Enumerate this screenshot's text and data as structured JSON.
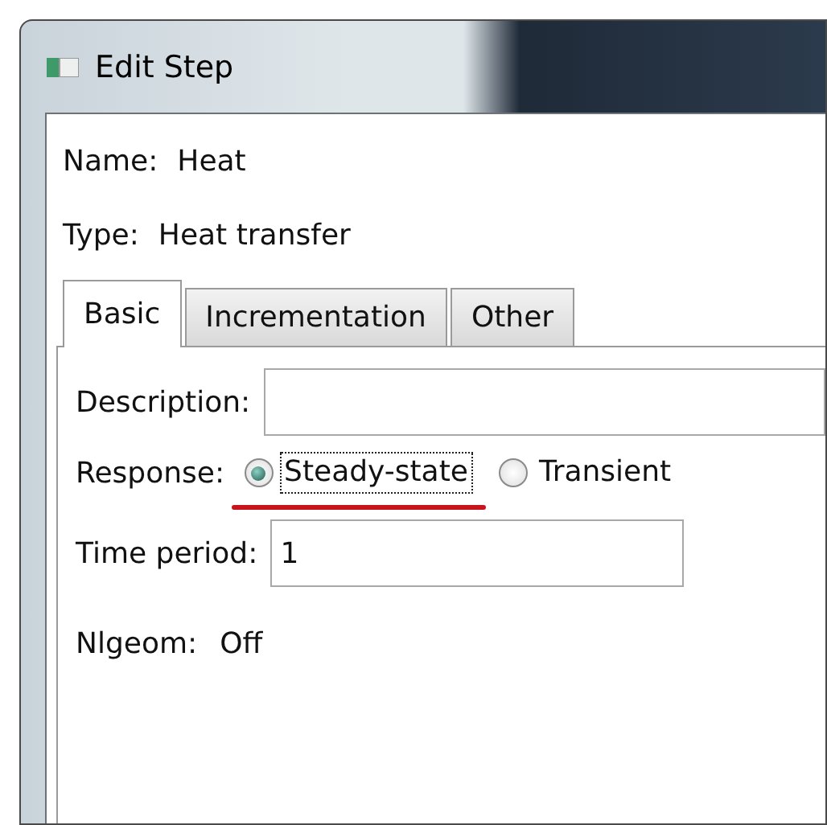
{
  "window": {
    "title": "Edit Step"
  },
  "name": {
    "label": "Name:",
    "value": "Heat"
  },
  "type": {
    "label": "Type:",
    "value": "Heat transfer"
  },
  "tabs": [
    {
      "label": "Basic",
      "selected": true
    },
    {
      "label": "Incrementation",
      "selected": false
    },
    {
      "label": "Other",
      "selected": false
    }
  ],
  "description": {
    "label": "Description:"
  },
  "response": {
    "label": "Response:",
    "options": [
      {
        "label": "Steady-state",
        "selected": true,
        "focused": true,
        "underlined": true
      },
      {
        "label": "Transient",
        "selected": false,
        "focused": false,
        "underlined": false
      }
    ]
  },
  "time_period": {
    "label": "Time period:",
    "value": "1"
  },
  "nlgeom": {
    "label": "Nlgeom:",
    "value": "Off"
  }
}
